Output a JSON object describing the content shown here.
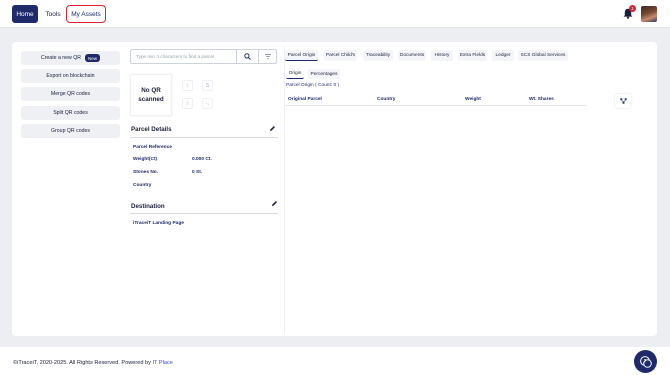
{
  "nav": {
    "home": "Home",
    "tools": "Tools",
    "my_assets": "My Assets",
    "notification_count": "1"
  },
  "sidebar": {
    "create_qr": "Create a new QR",
    "new_badge": "New",
    "export_blockchain": "Export on blockchain",
    "merge_qr": "Merge QR codes",
    "split_qr": "Split QR codes",
    "group_qr": "Group QR codes"
  },
  "search": {
    "placeholder": "Type min 3 characters to find a parcel"
  },
  "qr": {
    "status": "No QR scanned"
  },
  "parcel_details": {
    "title": "Parcel Details",
    "reference_label": "Parcel Reference",
    "weight_label": "Weight(Ct)",
    "weight_value": "0.000 Ct.",
    "stones_label": "Stones No.",
    "stones_value": "0 St.",
    "country_label": "Country"
  },
  "destination": {
    "title": "Destination",
    "landing_page": "iTraceiT Landing Page"
  },
  "tabs": [
    "Parcel Origin",
    "Parcel Child's",
    "Traceability",
    "Documents",
    "History",
    "Extra Fields",
    "Ledger",
    "SCS Global Services"
  ],
  "subtabs": [
    "Origin",
    "Percentages"
  ],
  "origin_table": {
    "count_label": "Parcel Origin ( Count: 0 )",
    "headers": [
      "Original Parcel",
      "Country",
      "Weight",
      "Wt. Shares"
    ]
  },
  "footer": {
    "copyright": "©iTraceiT, 2020-2025. All Rights Reserved. Powered by ",
    "link": "IT Place"
  },
  "colors": {
    "primary": "#1f2a6b",
    "highlight_border": "#d9232e",
    "background": "#eceef2"
  }
}
